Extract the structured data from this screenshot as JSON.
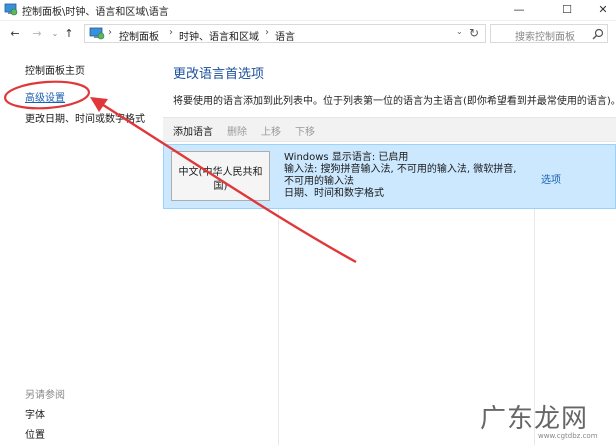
{
  "window": {
    "title": "控制面板\\时钟、语言和区域\\语言",
    "minimize": "—",
    "maximize": "☐",
    "close": "✕"
  },
  "nav": {
    "back": "←",
    "forward": "→",
    "history": "⌄",
    "up": "↑"
  },
  "address": {
    "crumbs": [
      "控制面板",
      "时钟、语言和区域",
      "语言"
    ],
    "separator": "›",
    "dropdown": "⌄",
    "refresh": "↻"
  },
  "search": {
    "placeholder": "搜索控制面板"
  },
  "left_pane": {
    "home": "控制面板主页",
    "advanced": "高级设置",
    "datetime": "更改日期、时间或数字格式",
    "see_also_title": "另请参阅",
    "fonts": "字体",
    "location": "位置"
  },
  "main": {
    "title": "更改语言首选项",
    "description": "将要使用的语言添加到此列表中。位于列表第一位的语言为主语言(即你希望看到并最常使用的语言)。",
    "toolbar": {
      "add": "添加语言",
      "remove": "删除",
      "move_up": "上移",
      "move_down": "下移"
    },
    "languages": [
      {
        "name": "中文(中华人民共和国)",
        "details": [
          "Windows 显示语言: 已启用",
          "输入法: 搜狗拼音输入法, 不可用的输入法, 微软拼音,",
          "不可用的输入法",
          "日期、时间和数字格式"
        ],
        "options": "选项"
      }
    ]
  },
  "watermark": {
    "text": "广东龙网",
    "url": "www.cgtdbz.com"
  },
  "colors": {
    "link": "#1a5fb4",
    "title": "#1a4f9c",
    "selection_bg": "#cce8ff",
    "annotation": "#e0383a"
  }
}
